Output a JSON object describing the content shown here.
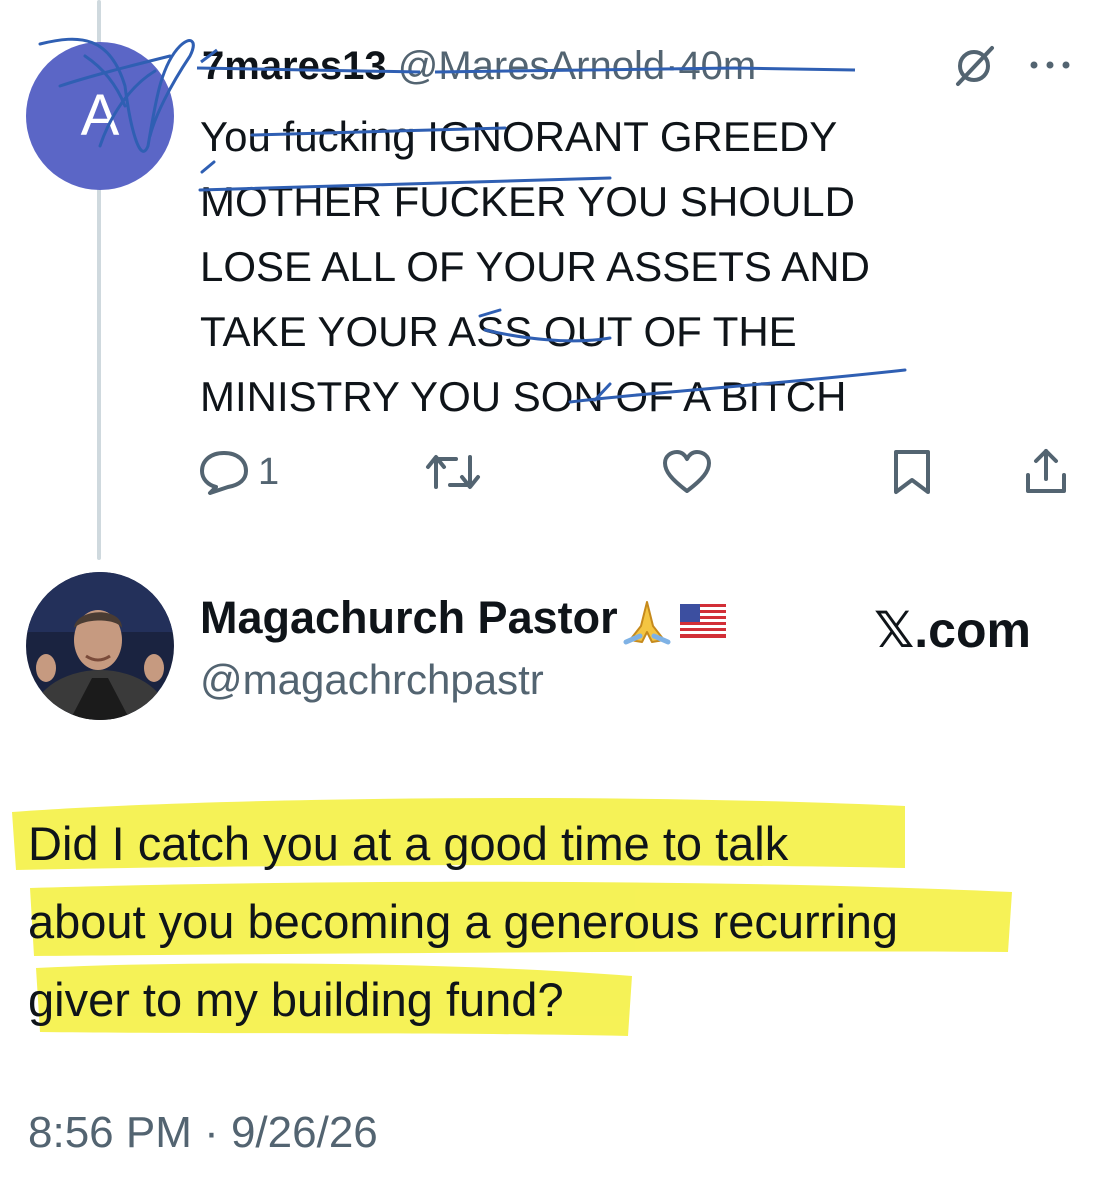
{
  "reply_tweet": {
    "avatar_letter": "A",
    "display_name": "7mares13",
    "handle": "@MaresArnold",
    "separator": "·",
    "time": "40m",
    "text": "You fucking IGNORANT GREEDY\nMOTHER FUCKER YOU SHOULD\nLOSE ALL OF YOUR ASSETS AND\nTAKE YOUR ASS OUT OF THE\nMINISTRY YOU SON OF A BITCH",
    "reply_count": "1",
    "icons": [
      "grok-icon",
      "more-icon",
      "reply-icon",
      "retweet-icon",
      "like-icon",
      "bookmark-icon",
      "share-icon"
    ],
    "annotation_color": "#2f5fb3"
  },
  "main_tweet": {
    "display_name": "Magachurch Pastor",
    "handle": "@magachrchpastr",
    "brand": "𝕏.com",
    "text": "Did I catch you at a good time to talk\nabout you becoming a generous recurring\ngiver to my building fund?",
    "timestamp": "8:56 PM · 9/26/26",
    "highlight_color": "#f4f03a"
  }
}
